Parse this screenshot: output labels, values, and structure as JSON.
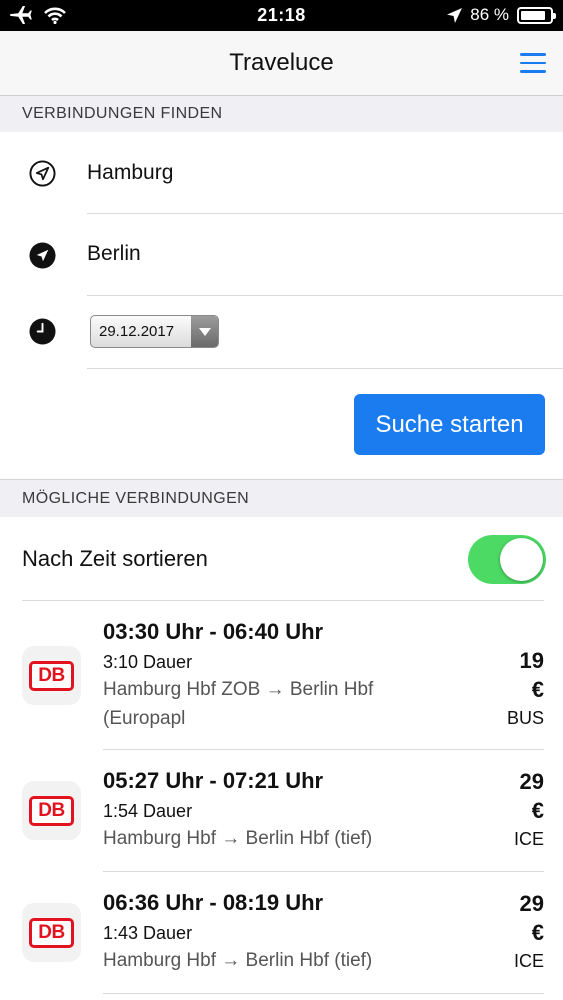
{
  "status_bar": {
    "time": "21:18",
    "battery": "86 %",
    "battery_level": 0.86
  },
  "nav": {
    "title": "Traveluce",
    "menu_icon": "hamburger-menu-icon"
  },
  "search": {
    "header": "VERBINDUNGEN FINDEN",
    "from": "Hamburg",
    "to": "Berlin",
    "date": "29.12.2017",
    "button_label": "Suche starten"
  },
  "results": {
    "header": "MÖGLICHE VERBINDUNGEN",
    "sort_label": "Nach Zeit sortieren",
    "sort_enabled": true,
    "connections": [
      {
        "times": "03:30 Uhr - 06:40 Uhr",
        "duration": "3:10 Dauer",
        "route": "Hamburg Hbf ZOB → Berlin Hbf",
        "route_cont": "(Europapl",
        "price": "19",
        "currency": "€",
        "type": "BUS",
        "logo": "DB"
      },
      {
        "times": "05:27 Uhr - 07:21 Uhr",
        "duration": "1:54 Dauer",
        "route": "Hamburg Hbf → Berlin Hbf (tief)",
        "price": "29",
        "currency": "€",
        "type": "ICE",
        "logo": "DB"
      },
      {
        "times": "06:36 Uhr - 08:19 Uhr",
        "duration": "1:43 Dauer",
        "route": "Hamburg Hbf → Berlin Hbf (tief)",
        "price": "29",
        "currency": "€",
        "type": "ICE",
        "logo": "DB"
      }
    ]
  },
  "colors": {
    "accent": "#1b7cf0",
    "toggle_on": "#4cd964",
    "db_red": "#e2131e"
  }
}
